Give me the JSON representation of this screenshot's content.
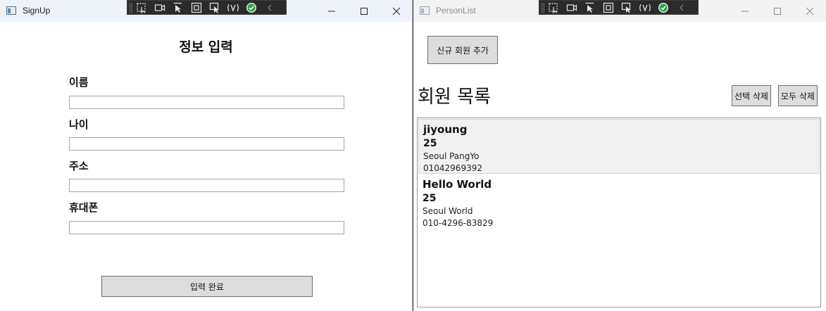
{
  "signup": {
    "window_title": "SignUp",
    "heading": "정보 입력",
    "fields": [
      {
        "label": "이름",
        "value": ""
      },
      {
        "label": "나이",
        "value": ""
      },
      {
        "label": "주소",
        "value": ""
      },
      {
        "label": "휴대폰",
        "value": ""
      }
    ],
    "submit_label": "입력 완료"
  },
  "personlist": {
    "window_title": "PersonList",
    "add_button_label": "신규 회원 추가",
    "list_title": "회원 목록",
    "delete_selected_label": "선택 삭제",
    "delete_all_label": "모두 삭제",
    "members": [
      {
        "name": "jiyoung",
        "age": "25",
        "address": "Seoul PangYo",
        "phone": "01042969392",
        "selected": true
      },
      {
        "name": "Hello World",
        "age": "25",
        "address": "Seoul World",
        "phone": "010-4296-83829",
        "selected": false
      }
    ]
  },
  "debug_toolbar": {
    "icons": [
      "select-element-icon",
      "record-icon",
      "cursor-icon",
      "layout-adorner-icon",
      "track-focus-icon",
      "binding-failures-icon",
      "hot-reload-ok-icon",
      "collapse-chevron-icon"
    ],
    "status_color": "#2ea043"
  },
  "colors": {
    "button_bg": "#dddddd",
    "selected_row_bg": "#f1f1f1"
  }
}
